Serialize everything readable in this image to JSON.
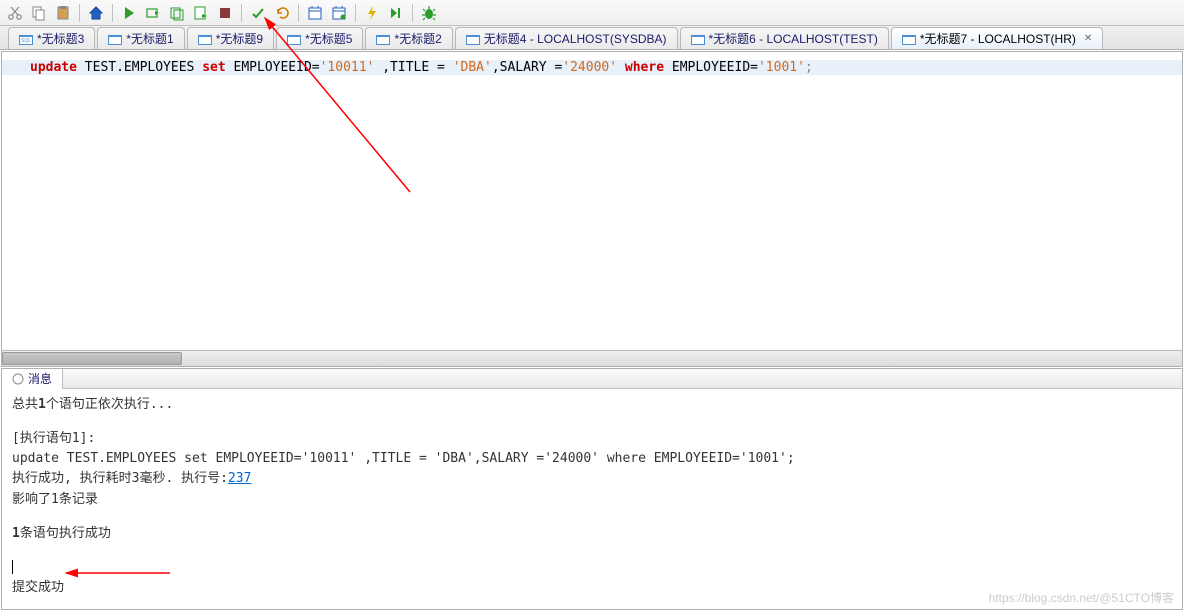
{
  "toolbar": {
    "cut": "cut-icon",
    "copy": "copy-icon",
    "paste": "paste-icon",
    "home": "home-icon",
    "run": "run-icon",
    "runStep": "run-step-icon",
    "runScript": "run-script-icon",
    "runNew": "run-new-icon",
    "stop": "stop-icon",
    "commit": "commit-icon",
    "rollback": "rollback-icon",
    "cal1": "plan-icon",
    "cal2": "plan2-icon",
    "flash": "flash-icon",
    "next": "next-icon",
    "debug": "debug-icon"
  },
  "tabs": [
    {
      "label": "*无标题3",
      "active": false
    },
    {
      "label": "*无标题1",
      "active": false
    },
    {
      "label": "*无标题9",
      "active": false
    },
    {
      "label": "*无标题5",
      "active": false
    },
    {
      "label": "*无标题2",
      "active": false
    },
    {
      "label": "无标题4 - LOCALHOST(SYSDBA)",
      "active": false
    },
    {
      "label": "*无标题6 - LOCALHOST(TEST)",
      "active": false
    },
    {
      "label": "*无标题7 - LOCALHOST(HR)",
      "active": true
    }
  ],
  "sql": {
    "kw_update": "update",
    "tbl": " TEST.EMPLOYEES ",
    "kw_set": "set",
    "c1": " EMPLOYEEID=",
    "v1": "'10011'",
    "c2": " ,TITLE = ",
    "v2": "'DBA'",
    "c3": ",SALARY =",
    "v3": "'24000'",
    "kw_where": " where ",
    "c4": "EMPLOYEEID=",
    "v4": "'1001'",
    "semi": ";"
  },
  "messages": {
    "panel_title": "消息",
    "l1_a": "总共",
    "l1_b": "1",
    "l1_c": "个语句正依次执行...",
    "l2": "[执行语句1]:",
    "l3": "update TEST.EMPLOYEES set EMPLOYEEID='10011' ,TITLE = 'DBA',SALARY ='24000' where EMPLOYEEID='1001';",
    "l4_a": "执行成功, 执行耗时3毫秒. 执行号:",
    "l4_link": "237",
    "l5": "影响了1条记录",
    "l6_a": "1",
    "l6_b": "条语句执行成功",
    "l7": "提交成功"
  },
  "watermark": "https://blog.csdn.net/@51CTO博客"
}
